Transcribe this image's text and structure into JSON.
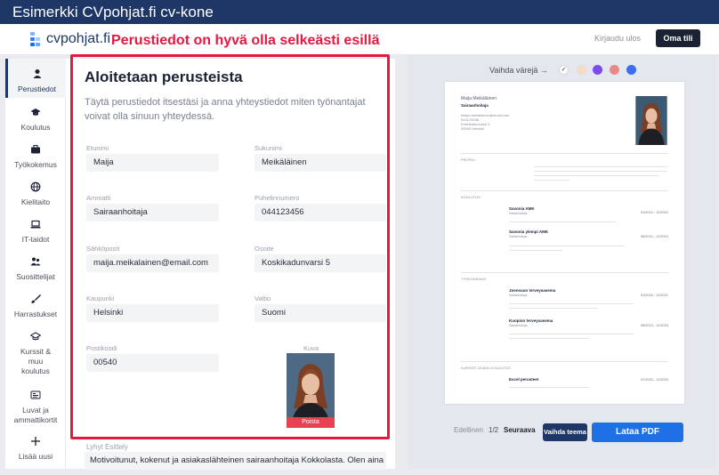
{
  "banner": {
    "title": "Esimerkki CVpohjat.fi cv-kone"
  },
  "header": {
    "logo_text": "cvpohjat.fi",
    "annotation": "Perustiedot on hyvä olla selkeästi esillä",
    "logout": "Kirjaudu ulos",
    "account": "Oma tili"
  },
  "sidebar": {
    "items": [
      {
        "label": "Perustiedot",
        "icon": "person-icon"
      },
      {
        "label": "Koulutus",
        "icon": "graduation-cap-icon"
      },
      {
        "label": "Työkokemus",
        "icon": "briefcase-icon"
      },
      {
        "label": "Kielitaito",
        "icon": "globe-icon"
      },
      {
        "label": "IT-taidot",
        "icon": "laptop-icon"
      },
      {
        "label": "Suosittelijat",
        "icon": "people-icon"
      },
      {
        "label": "Harrastukset",
        "icon": "brush-icon"
      },
      {
        "label": "Kurssit & muu koulutus",
        "icon": "mortarboard-icon"
      },
      {
        "label": "Luvat ja ammattikortit",
        "icon": "id-card-icon"
      },
      {
        "label": "Lisää uusi",
        "icon": "plus-icon"
      }
    ]
  },
  "form": {
    "title": "Aloitetaan perusteista",
    "lead": "Täytä perustiedot itsestäsi ja anna yhteystiedot miten työnantajat voivat olla sinuun yhteydessä.",
    "fields": {
      "first_name": {
        "label": "Etunimi",
        "value": "Maija"
      },
      "last_name": {
        "label": "Sukunimi",
        "value": "Meikäläinen"
      },
      "profession": {
        "label": "Ammatti",
        "value": "Sairaanhoitaja"
      },
      "phone": {
        "label": "Puhelinnumero",
        "value": "044123456"
      },
      "email": {
        "label": "Sähköposti",
        "value": "maija.meikalainen@email.com"
      },
      "address": {
        "label": "Osoite",
        "value": "Koskikadunvarsi 5"
      },
      "city": {
        "label": "Kaupunki",
        "value": "Helsinki"
      },
      "country": {
        "label": "Valtio",
        "value": "Suomi"
      },
      "postcode": {
        "label": "Postikoodi",
        "value": "00540"
      }
    },
    "photo_label": "Kuva",
    "photo_remove": "Poista",
    "summary_label": "Lyhyt Esittely",
    "summary_value": "Motivoitunut, kokenut ja asiakaslähteinen sairaanhoitaja Kokkolasta. Olen aina"
  },
  "preview": {
    "color_label": "Vaihda värejä →",
    "swatches": [
      "#ffffff",
      "#f3dcc9",
      "#7a4cf0",
      "#e88a8a",
      "#3b6ef0"
    ],
    "cv": {
      "name": "Maija Meikäläinen",
      "title": "Sairaanhoitaja",
      "contact": [
        "maija.meikalainen@email.com",
        "044123456",
        "Koskikadunvarsi 5",
        "00540 Helsinki"
      ],
      "sections": {
        "profile": "PROFIILI",
        "education": "KOULUTUS",
        "work": "TYÖKOKEMUS",
        "courses": "KURSSIT JA MUU KOULUTUS"
      },
      "edu": [
        {
          "school": "Savonia AMK",
          "degree": "Sairaanhoitaja",
          "place": "Kuopio",
          "dates": "01/2010 - 12/2010"
        },
        {
          "school": "Savonia ylempi AMK",
          "degree": "Sairaanhoitaja",
          "place": "Kuopio",
          "dates": "08/2010 - 12/2013"
        }
      ],
      "jobs": [
        {
          "company": "Joensuun terveysasema",
          "role": "Sairaanhoitaja",
          "place": "Joensuu",
          "dates": "01/2016 - 12/2021"
        },
        {
          "company": "Kuopion terveysasema",
          "role": "Sairaanhoitaja",
          "place": "Kuopio",
          "dates": "08/2013 - 12/2015"
        }
      ],
      "course": {
        "name": "Excel perusteet",
        "dates": "07/2020 - 12/2020"
      }
    },
    "pager": {
      "prev": "Edellinen",
      "page": "1/2",
      "next": "Seuraava"
    },
    "theme_button": "Vaihda teema",
    "pdf_button": "Lataa PDF"
  }
}
